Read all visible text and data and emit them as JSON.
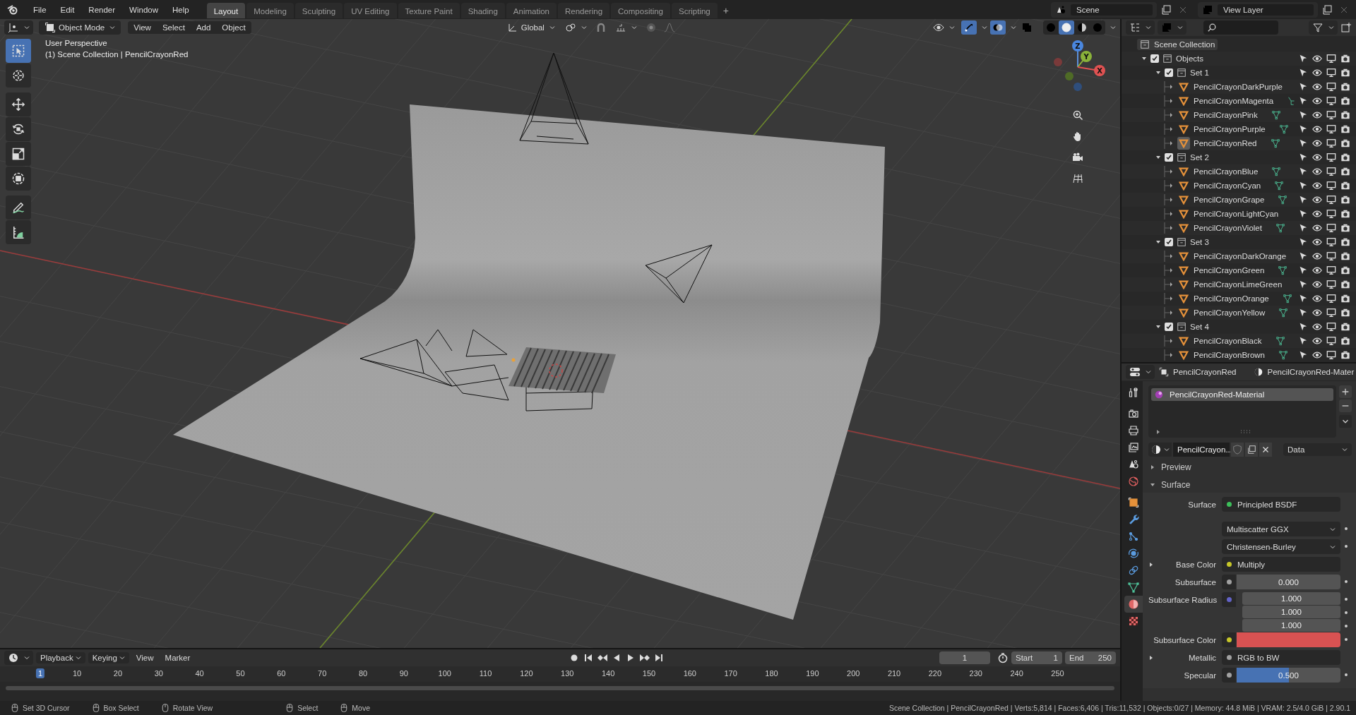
{
  "menu": [
    "File",
    "Edit",
    "Render",
    "Window",
    "Help"
  ],
  "workspaces": [
    {
      "label": "Layout",
      "selected": true
    },
    {
      "label": "Modeling",
      "selected": false
    },
    {
      "label": "Sculpting",
      "selected": false
    },
    {
      "label": "UV Editing",
      "selected": false
    },
    {
      "label": "Texture Paint",
      "selected": false
    },
    {
      "label": "Shading",
      "selected": false
    },
    {
      "label": "Animation",
      "selected": false
    },
    {
      "label": "Rendering",
      "selected": false
    },
    {
      "label": "Compositing",
      "selected": false
    },
    {
      "label": "Scripting",
      "selected": false
    }
  ],
  "add_workspace": "+",
  "scene": "Scene",
  "view_layer": "View Layer",
  "viewport": {
    "mode": "Object Mode",
    "menus": [
      "View",
      "Select",
      "Add",
      "Object"
    ],
    "orientation": "Global",
    "toggles": [
      {
        "kind": "gizmo",
        "on": true
      },
      {
        "kind": "overlay",
        "on": true
      },
      {
        "kind": "xray",
        "on": false
      }
    ],
    "shading": [
      {
        "kind": "wireframe",
        "selected": false
      },
      {
        "kind": "solid",
        "selected": true
      },
      {
        "kind": "material",
        "selected": false
      },
      {
        "kind": "rendered",
        "selected": false
      }
    ],
    "title": "User Perspective",
    "subtitle": "(1) Scene Collection | PencilCrayonRed",
    "tools": [
      {
        "kind": "select",
        "selected": true
      },
      {
        "kind": "cursor",
        "selected": false
      },
      {
        "kind": "move",
        "selected": false
      },
      {
        "kind": "rotate",
        "selected": false
      },
      {
        "kind": "scale",
        "selected": false
      },
      {
        "kind": "transform",
        "selected": false
      },
      {
        "kind": "annotate",
        "selected": false
      },
      {
        "kind": "measure",
        "selected": false
      }
    ],
    "gizmo_axes": [
      "X",
      "Y",
      "Z"
    ]
  },
  "outliner": {
    "root": "Scene Collection",
    "tree": [
      {
        "label": "Objects",
        "checked": true,
        "expanded": true,
        "children": [
          {
            "label": "Set 1",
            "checked": true,
            "expanded": true,
            "children": [
              {
                "label": "PencilCrayonDarkPurple",
                "kind": "none",
                "active": false
              },
              {
                "label": "PencilCrayonMagenta",
                "kind": "bones",
                "active": false
              },
              {
                "label": "PencilCrayonPink",
                "kind": "mesh",
                "active": false
              },
              {
                "label": "PencilCrayonPurple",
                "kind": "mesh",
                "active": false
              },
              {
                "label": "PencilCrayonRed",
                "kind": "mesh",
                "active": true
              }
            ]
          },
          {
            "label": "Set 2",
            "checked": true,
            "expanded": true,
            "children": [
              {
                "label": "PencilCrayonBlue",
                "kind": "mesh",
                "active": false
              },
              {
                "label": "PencilCrayonCyan",
                "kind": "mesh",
                "active": false
              },
              {
                "label": "PencilCrayonGrape",
                "kind": "mesh",
                "active": false
              },
              {
                "label": "PencilCrayonLightCyan",
                "kind": "none",
                "active": false
              },
              {
                "label": "PencilCrayonViolet",
                "kind": "mesh",
                "active": false
              }
            ]
          },
          {
            "label": "Set 3",
            "checked": true,
            "expanded": true,
            "children": [
              {
                "label": "PencilCrayonDarkOrange",
                "kind": "none",
                "active": false
              },
              {
                "label": "PencilCrayonGreen",
                "kind": "mesh",
                "active": false
              },
              {
                "label": "PencilCrayonLimeGreen",
                "kind": "none",
                "active": false
              },
              {
                "label": "PencilCrayonOrange",
                "kind": "mesh",
                "active": false
              },
              {
                "label": "PencilCrayonYellow",
                "kind": "mesh",
                "active": false
              }
            ]
          },
          {
            "label": "Set 4",
            "checked": true,
            "expanded": true,
            "children": [
              {
                "label": "PencilCrayonBlack",
                "kind": "mesh",
                "active": false
              },
              {
                "label": "PencilCrayonBrown",
                "kind": "mesh",
                "active": false
              }
            ]
          }
        ]
      }
    ]
  },
  "properties": {
    "object": "PencilCrayonRed",
    "material_path": "PencilCrayonRed-Mater",
    "tabs": [
      {
        "kind": "tool",
        "selected": false
      },
      {
        "kind": "render",
        "selected": false
      },
      {
        "kind": "output",
        "selected": false
      },
      {
        "kind": "view-layer",
        "selected": false
      },
      {
        "kind": "scene",
        "selected": false
      },
      {
        "kind": "world",
        "selected": false
      },
      {
        "kind": "object",
        "selected": false
      },
      {
        "kind": "modifiers",
        "selected": false
      },
      {
        "kind": "particles",
        "selected": false
      },
      {
        "kind": "physics",
        "selected": false
      },
      {
        "kind": "constraints",
        "selected": false
      },
      {
        "kind": "data",
        "selected": false
      },
      {
        "kind": "material",
        "selected": true
      },
      {
        "kind": "texture",
        "selected": false
      }
    ],
    "slots": [
      {
        "label": "PencilCrayonRed-Material",
        "selected": true
      }
    ],
    "material_name": "PencilCrayon...",
    "link": "Data",
    "panels": [
      {
        "label": "Preview",
        "expanded": false
      },
      {
        "label": "Surface",
        "expanded": true,
        "rows": [
          {
            "kind": "link",
            "label": "Surface",
            "color": "#3cbf5a",
            "value": "Principled BSDF",
            "expandable": false
          },
          {
            "kind": "dropdown",
            "value": "Multiscatter GGX",
            "expandable": false
          },
          {
            "kind": "dropdown",
            "value": "Christensen-Burley",
            "expandable": false
          },
          {
            "kind": "link",
            "label": "Base Color",
            "color": "#c7c729",
            "value": "Multiply",
            "expandable": true
          },
          {
            "kind": "slider",
            "label": "Subsurface",
            "color": "#a1a1a1",
            "value": "0.000",
            "expandable": false
          },
          {
            "kind": "vector",
            "label": "Subsurface Radius",
            "color": "#6363c7",
            "values": [
              "1.000",
              "1.000",
              "1.000"
            ],
            "expandable": false
          },
          {
            "kind": "color",
            "label": "Subsurface Color",
            "color": "#c7c729",
            "swatch": {
              "color": "#d95252"
            },
            "expandable": false
          },
          {
            "kind": "link",
            "label": "Metallic",
            "color": "#a1a1a1",
            "value": "RGB to BW",
            "expandable": true
          },
          {
            "kind": "slider",
            "label": "Specular",
            "color": "#a1a1a1",
            "value": "0.500",
            "level": 0.5,
            "expandable": false
          }
        ]
      }
    ]
  },
  "timeline": {
    "menus": [
      {
        "label": "Playback",
        "dropdown": true
      },
      {
        "label": "Keying",
        "dropdown": true
      },
      {
        "label": "View",
        "dropdown": false
      },
      {
        "label": "Marker",
        "dropdown": false
      }
    ],
    "current_frame": "1",
    "start_label": "Start",
    "start": "1",
    "end_label": "End",
    "end": "250",
    "ticks": [
      {
        "label": "1",
        "selected": true
      },
      {
        "label": "10",
        "selected": false
      },
      {
        "label": "20",
        "selected": false
      },
      {
        "label": "30",
        "selected": false
      },
      {
        "label": "40",
        "selected": false
      },
      {
        "label": "50",
        "selected": false
      },
      {
        "label": "60",
        "selected": false
      },
      {
        "label": "70",
        "selected": false
      },
      {
        "label": "80",
        "selected": false
      },
      {
        "label": "90",
        "selected": false
      },
      {
        "label": "100",
        "selected": false
      },
      {
        "label": "110",
        "selected": false
      },
      {
        "label": "120",
        "selected": false
      },
      {
        "label": "130",
        "selected": false
      },
      {
        "label": "140",
        "selected": false
      },
      {
        "label": "150",
        "selected": false
      },
      {
        "label": "160",
        "selected": false
      },
      {
        "label": "170",
        "selected": false
      },
      {
        "label": "180",
        "selected": false
      },
      {
        "label": "190",
        "selected": false
      },
      {
        "label": "200",
        "selected": false
      },
      {
        "label": "210",
        "selected": false
      },
      {
        "label": "220",
        "selected": false
      },
      {
        "label": "230",
        "selected": false
      },
      {
        "label": "240",
        "selected": false
      },
      {
        "label": "250",
        "selected": false
      }
    ]
  },
  "status_bar": {
    "hints": [
      "Set 3D Cursor",
      "Box Select",
      "Rotate View",
      "Select",
      "Move"
    ],
    "stats": "Scene Collection | PencilCrayonRed | Verts:5,814 | Faces:6,406 | Tris:11,532 | Objects:0/27 | Memory: 44.8 MiB | VRAM: 2.5/4.0 GiB | 2.90.1"
  }
}
